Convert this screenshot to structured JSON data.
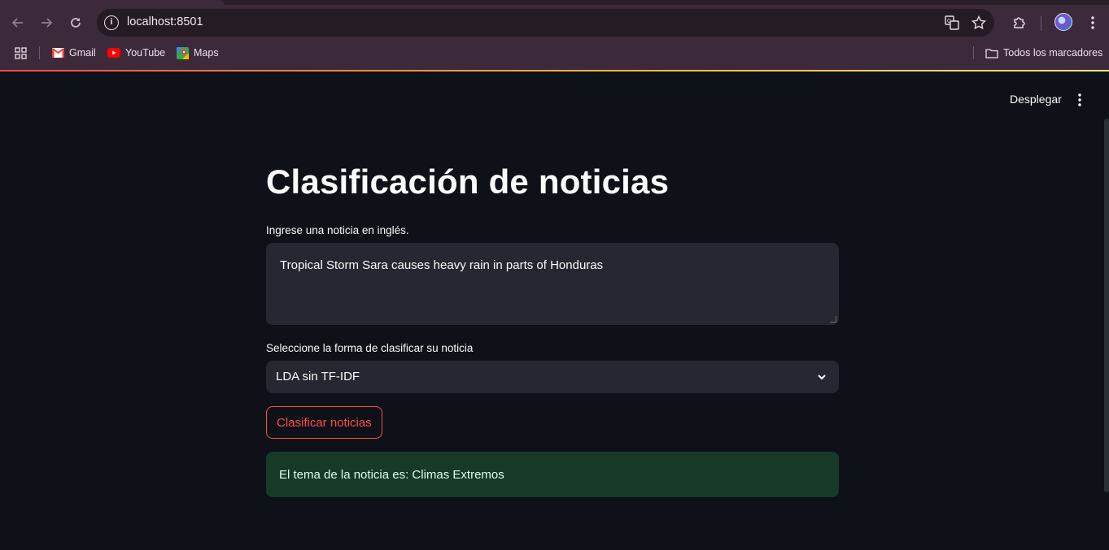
{
  "browser": {
    "url": "localhost:8501",
    "bookmarks": [
      {
        "label": "Gmail",
        "icon": "gmail-icon"
      },
      {
        "label": "YouTube",
        "icon": "youtube-icon"
      },
      {
        "label": "Maps",
        "icon": "maps-icon"
      }
    ],
    "all_bookmarks_label": "Todos los marcadores"
  },
  "header": {
    "deploy_label": "Desplegar"
  },
  "main": {
    "title": "Clasificación de noticias",
    "input_label": "Ingrese una noticia en inglés.",
    "input_value": "Tropical Storm Sara causes heavy rain in parts of Honduras",
    "select_label": "Seleccione la forma de clasificar su noticia",
    "select_value": "LDA sin TF-IDF",
    "button_label": "Clasificar noticias",
    "result_text": "El tema de la noticia es: Climas Extremos"
  },
  "colors": {
    "accent": "#ff4b4b",
    "background": "#0e1117",
    "widget_bg": "#262730",
    "success_bg": "#173928"
  }
}
